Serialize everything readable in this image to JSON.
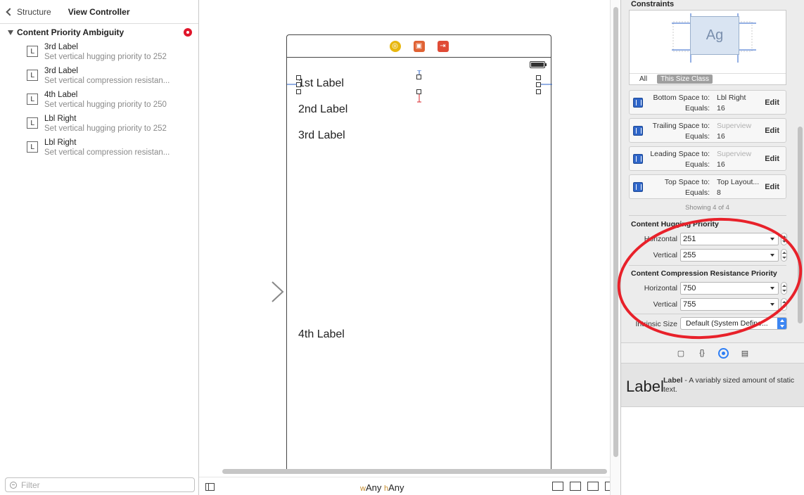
{
  "navigator": {
    "back_label": "Structure",
    "title": "View Controller",
    "section_label": "Content Priority Ambiguity",
    "filter_placeholder": "Filter",
    "issues": [
      {
        "icon": "L",
        "title": "3rd Label",
        "detail": "Set vertical hugging priority to 252"
      },
      {
        "icon": "L",
        "title": "3rd Label",
        "detail": "Set vertical compression resistan..."
      },
      {
        "icon": "L",
        "title": "4th Label",
        "detail": "Set vertical hugging priority to 250"
      },
      {
        "icon": "L",
        "title": "Lbl Right",
        "detail": "Set vertical hugging priority to 252"
      },
      {
        "icon": "L",
        "title": "Lbl Right",
        "detail": "Set vertical compression resistan..."
      }
    ]
  },
  "canvas": {
    "labels": {
      "first": "1st Label",
      "second": "2nd Label",
      "third": "3rd Label",
      "fourth": "4th Label"
    },
    "size_class": {
      "w_prefix": "w",
      "w_value": "Any",
      "h_prefix": "h",
      "h_value": "Any"
    }
  },
  "inspector": {
    "constraints_title": "Constraints",
    "preview_text": "Ag",
    "tab_all": "All",
    "tab_size_class": "This Size Class",
    "constraints": [
      {
        "key": "Bottom Space to:",
        "value": "Lbl Right",
        "value_muted": false,
        "equals_key": "Equals:",
        "equals": "16",
        "edit": "Edit"
      },
      {
        "key": "Trailing Space to:",
        "value": "Superview",
        "value_muted": true,
        "equals_key": "Equals:",
        "equals": "16",
        "edit": "Edit"
      },
      {
        "key": "Leading Space to:",
        "value": "Superview",
        "value_muted": true,
        "equals_key": "Equals:",
        "equals": "16",
        "edit": "Edit"
      },
      {
        "key": "Top Space to:",
        "value": "Top Layout...",
        "value_muted": false,
        "equals_key": "Equals:",
        "equals": "8",
        "edit": "Edit"
      }
    ],
    "showing": "Showing 4 of 4",
    "hugging": {
      "title": "Content Hugging Priority",
      "horizontal_label": "Horizontal",
      "horizontal": "251",
      "vertical_label": "Vertical",
      "vertical": "255"
    },
    "compression": {
      "title": "Content Compression Resistance Priority",
      "horizontal_label": "Horizontal",
      "horizontal": "750",
      "vertical_label": "Vertical",
      "vertical": "755"
    },
    "intrinsic": {
      "label": "Intrinsic Size",
      "value": "Default (System Define..."
    }
  },
  "library": {
    "item_big": "Label",
    "item_name": "Label",
    "item_desc": " - A variably sized amount of static text."
  },
  "colors": {
    "annotation": "#e8212a",
    "accent": "#2d7ef5",
    "error": "#e0162b"
  }
}
